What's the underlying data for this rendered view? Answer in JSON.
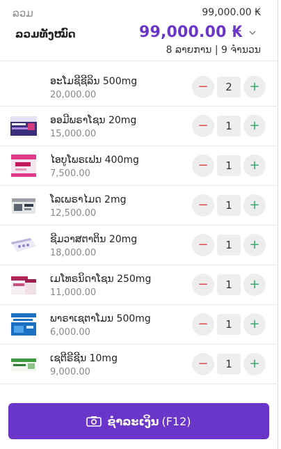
{
  "header": {
    "subtotal_label": "ລວມ",
    "subtotal_value": "99,000.00 ₭",
    "total_label": "ລວມທັງໝົດ",
    "total_value": "99,000.00 ₭",
    "summary": "8 ລາຍການ | 9 ຈຳນວນ",
    "accent_color": "#6a35c9"
  },
  "items": [
    {
      "name": "ອະໂມຊີຊີລິນ 500mg",
      "price": "20,000.00",
      "qty": "2"
    },
    {
      "name": "ອອມີພຣາໂຊນ 20mg",
      "price": "15,000.00",
      "qty": "1"
    },
    {
      "name": "ໄອບູໂພຣເຟນ 400mg",
      "price": "7,500.00",
      "qty": "1"
    },
    {
      "name": "ໂລເພຣາໄມດ 2mg",
      "price": "12,500.00",
      "qty": "1"
    },
    {
      "name": "ຊີມວາສຕາຕິນ 20mg",
      "price": "18,000.00",
      "qty": "1"
    },
    {
      "name": "ເມໂທຣນິດາໂຊນ 250mg",
      "price": "11,000.00",
      "qty": "1"
    },
    {
      "name": "ພາຣາເຊຕາໂມນ 500mg",
      "price": "6,000.00",
      "qty": "1"
    },
    {
      "name": "ເຊຕີຣີຊີນ 10mg",
      "price": "9,000.00",
      "qty": "1"
    }
  ],
  "controls": {
    "minus": "−",
    "plus": "+"
  },
  "pay_button": {
    "label": "ຊຳລະເງິນ",
    "shortcut": "(F12)"
  }
}
